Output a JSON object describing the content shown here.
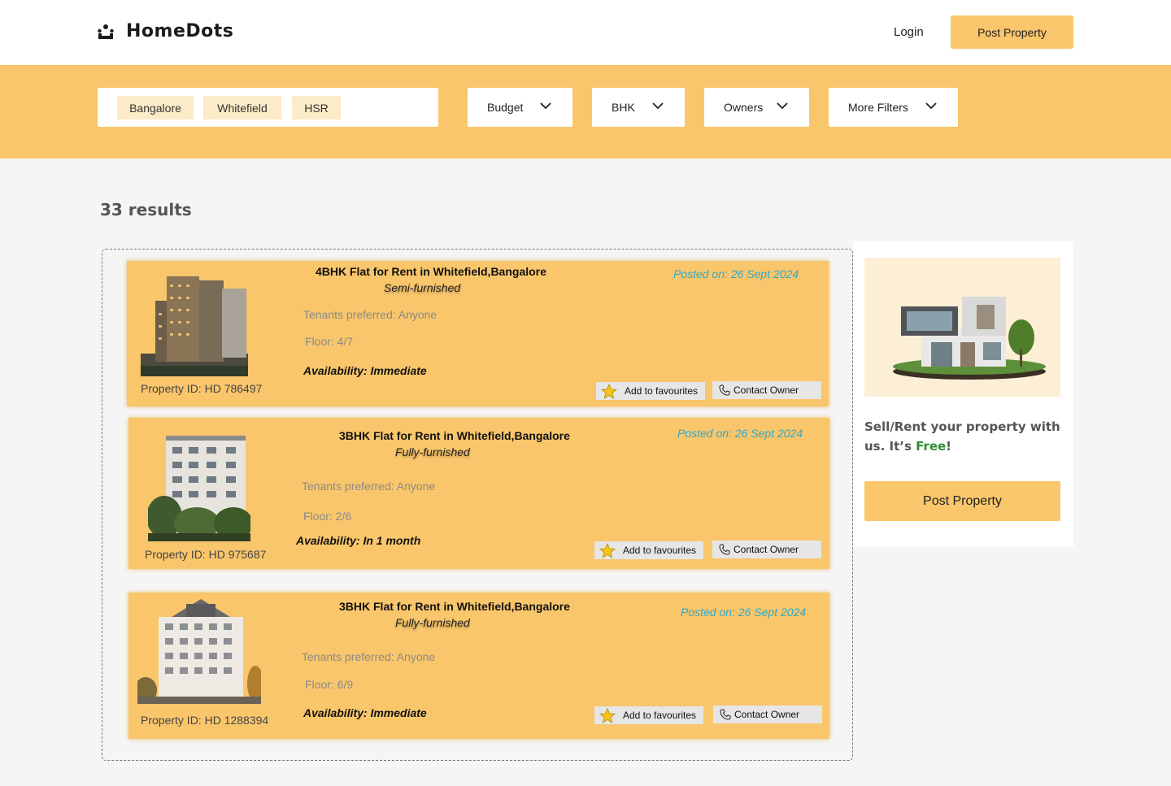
{
  "header": {
    "brand": "HomeDots",
    "brand_icon": "house-people-icon",
    "login_label": "Login",
    "post_property_label": "Post Property"
  },
  "filters": {
    "locations": [
      "Bangalore",
      "Whitefield",
      "HSR"
    ],
    "dropdowns": [
      {
        "label": "Budget"
      },
      {
        "label": "BHK"
      },
      {
        "label": "Owners"
      },
      {
        "label": "More Filters"
      }
    ]
  },
  "results": {
    "count_text": "33 results"
  },
  "listings": [
    {
      "title": "4BHK Flat for Rent in Whitefield,Bangalore",
      "furnishing": "Semi-furnished",
      "posted": "Posted on: 26  Sept 2024",
      "tenants": "Tenants preferred: Anyone",
      "floor": "Floor: 4/7",
      "availability": "Availability: Immediate",
      "property_id": "Property ID: HD 786497",
      "fav_label": "Add to favourites",
      "contact_label": "Contact Owner"
    },
    {
      "title": "3BHK Flat for Rent in Whitefield,Bangalore",
      "furnishing": "Fully-furnished",
      "posted": "Posted on: 26  Sept 2024",
      "tenants": "Tenants preferred: Anyone",
      "floor": "Floor: 2/6",
      "availability": "Availability: In 1 month",
      "property_id": "Property ID: HD 975687",
      "fav_label": "Add to favourites",
      "contact_label": "Contact Owner"
    },
    {
      "title": "3BHK Flat for Rent in Whitefield,Bangalore",
      "furnishing": "Fully-furnished",
      "posted": "Posted on: 26  Sept 2024",
      "tenants": "Tenants preferred: Anyone",
      "floor": "Floor: 6/9",
      "availability": "Availability: Immediate",
      "property_id": "Property ID: HD 1288394",
      "fav_label": "Add to favourites",
      "contact_label": "Contact Owner"
    }
  ],
  "sidebar": {
    "promo_text": "Sell/Rent your property with us. It’s ",
    "promo_highlight": "Free",
    "promo_end": "!",
    "post_property_label": "Post Property"
  },
  "colors": {
    "accent": "#f9c66b",
    "chip": "#fcebc9",
    "posted": "#2fa8c8",
    "free": "#2e8b2e"
  }
}
